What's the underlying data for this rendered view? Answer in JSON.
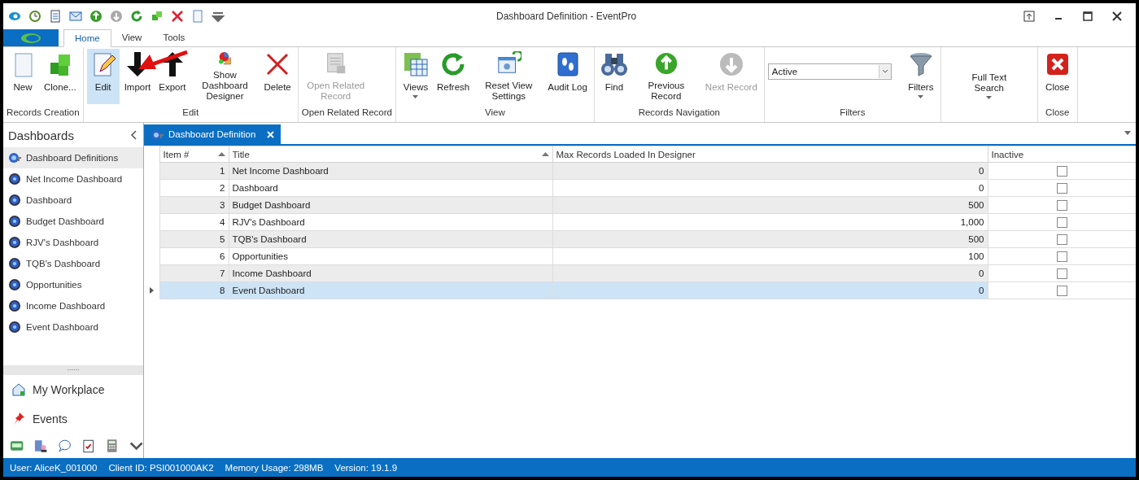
{
  "window": {
    "title": "Dashboard Definition - EventPro"
  },
  "ribbon_tabs": [
    {
      "label": "Home",
      "selected": true
    },
    {
      "label": "View",
      "selected": false
    },
    {
      "label": "Tools",
      "selected": false
    }
  ],
  "ribbon_groups": [
    {
      "label": "Records Creation",
      "items": [
        {
          "kind": "button",
          "label": "New",
          "disabled": false,
          "highlighted": false
        },
        {
          "kind": "button",
          "label": "Clone...",
          "disabled": false,
          "highlighted": false
        }
      ]
    },
    {
      "label": "Edit",
      "items": [
        {
          "kind": "button",
          "label": "Edit",
          "disabled": false,
          "highlighted": true
        },
        {
          "kind": "button",
          "label": "Import",
          "disabled": false,
          "highlighted": false
        },
        {
          "kind": "button",
          "label": "Export",
          "disabled": false,
          "highlighted": false
        },
        {
          "kind": "button",
          "label": "Show Dashboard Designer",
          "disabled": false,
          "highlighted": false
        },
        {
          "kind": "button",
          "label": "Delete",
          "disabled": false,
          "highlighted": false
        }
      ]
    },
    {
      "label": "Open Related Record",
      "items": [
        {
          "kind": "button",
          "label": "Open Related Record",
          "disabled": true,
          "highlighted": false
        }
      ]
    },
    {
      "label": "View",
      "items": [
        {
          "kind": "button",
          "label": "Views",
          "disabled": false,
          "highlighted": false,
          "dropdown": true
        },
        {
          "kind": "button",
          "label": "Refresh",
          "disabled": false,
          "highlighted": false
        },
        {
          "kind": "button",
          "label": "Reset View Settings",
          "disabled": false,
          "highlighted": false
        },
        {
          "kind": "button",
          "label": "Audit Log",
          "disabled": false,
          "highlighted": false
        }
      ]
    },
    {
      "label": "Records Navigation",
      "items": [
        {
          "kind": "button",
          "label": "Find",
          "disabled": false,
          "highlighted": false
        },
        {
          "kind": "button",
          "label": "Previous Record",
          "disabled": false,
          "highlighted": false
        },
        {
          "kind": "button",
          "label": "Next Record",
          "disabled": true,
          "highlighted": false
        }
      ]
    },
    {
      "label": "Filters",
      "items": [
        {
          "kind": "combo",
          "value": "Active"
        },
        {
          "kind": "button",
          "label": "Filters",
          "disabled": false,
          "highlighted": false,
          "dropdown": true
        }
      ]
    },
    {
      "items": [
        {
          "kind": "textbutton",
          "label": "Full Text Search",
          "disabled": false,
          "highlighted": false,
          "dropdown": true
        }
      ]
    },
    {
      "label": "Close",
      "items": [
        {
          "kind": "button",
          "label": "Close",
          "disabled": false,
          "highlighted": false
        }
      ]
    }
  ],
  "sidebar": {
    "title": "Dashboards",
    "items": [
      {
        "label": "Dashboard Definitions",
        "selected": true
      },
      {
        "label": "Net Income Dashboard",
        "selected": false
      },
      {
        "label": "Dashboard",
        "selected": false
      },
      {
        "label": "Budget Dashboard",
        "selected": false
      },
      {
        "label": "RJV's Dashboard",
        "selected": false
      },
      {
        "label": "TQB's Dashboard",
        "selected": false
      },
      {
        "label": "Opportunities",
        "selected": false
      },
      {
        "label": "Income Dashboard",
        "selected": false
      },
      {
        "label": "Event Dashboard",
        "selected": false
      }
    ],
    "grip": "......",
    "nav": [
      {
        "label": "My Workplace"
      },
      {
        "label": "Events"
      }
    ]
  },
  "doc_tab": {
    "label": "Dashboard Definition"
  },
  "table": {
    "columns": [
      {
        "label": "Item #",
        "sorted": true
      },
      {
        "label": "Title",
        "sorted": true
      },
      {
        "label": "Max Records Loaded In Designer",
        "sorted": false
      },
      {
        "label": "Inactive",
        "sorted": false
      }
    ],
    "rows": [
      {
        "item": "1",
        "title": "Net Income Dashboard",
        "max": "0",
        "inactive": false,
        "selected": false
      },
      {
        "item": "2",
        "title": "Dashboard",
        "max": "0",
        "inactive": false,
        "selected": false
      },
      {
        "item": "3",
        "title": "Budget Dashboard",
        "max": "500",
        "inactive": false,
        "selected": false
      },
      {
        "item": "4",
        "title": "RJV's Dashboard",
        "max": "1,000",
        "inactive": false,
        "selected": false
      },
      {
        "item": "5",
        "title": "TQB's Dashboard",
        "max": "500",
        "inactive": false,
        "selected": false
      },
      {
        "item": "6",
        "title": "Opportunities",
        "max": "100",
        "inactive": false,
        "selected": false
      },
      {
        "item": "7",
        "title": "Income Dashboard",
        "max": "0",
        "inactive": false,
        "selected": false
      },
      {
        "item": "8",
        "title": "Event Dashboard",
        "max": "0",
        "inactive": false,
        "selected": true
      }
    ]
  },
  "status_bar": [
    "User: AliceK_001000",
    "Client ID: PSI001000AK2",
    "Memory Usage: 298MB",
    "Version: 19.1.9"
  ]
}
